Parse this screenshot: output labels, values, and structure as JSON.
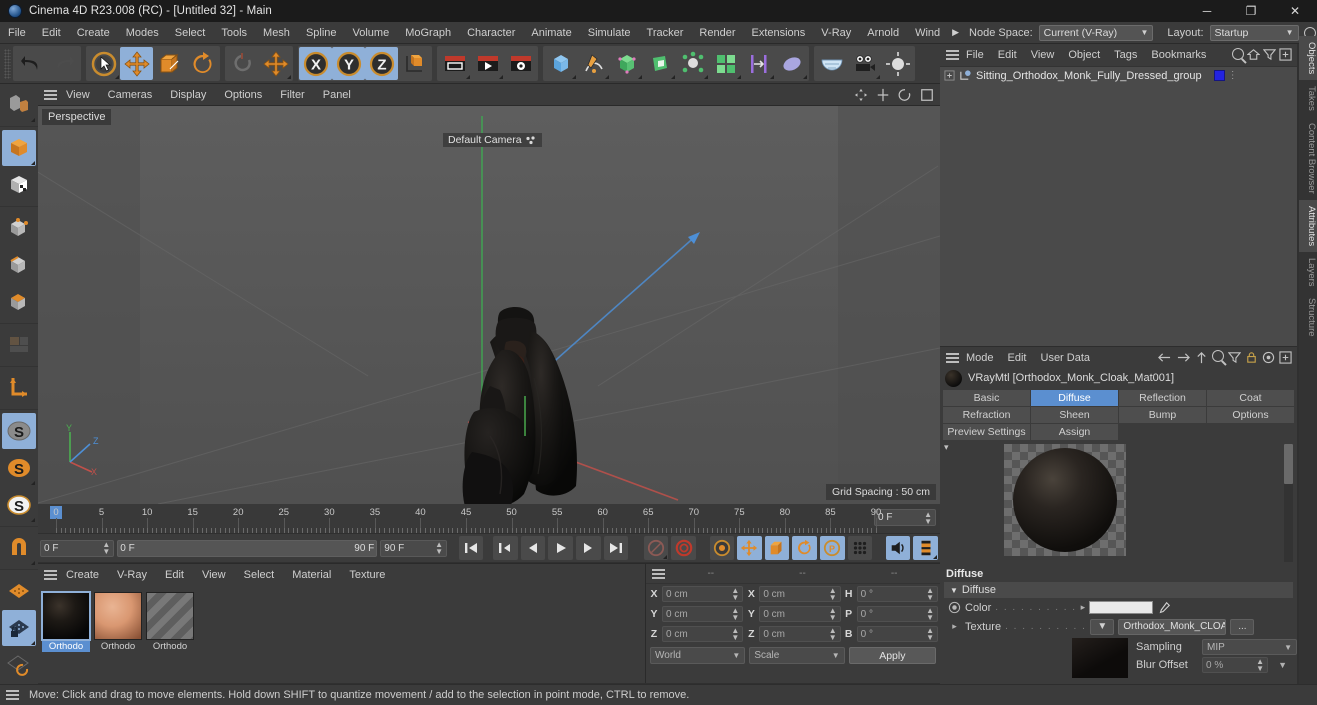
{
  "window": {
    "title": "Cinema 4D R23.008 (RC) - [Untitled 32] - Main",
    "minimize": "─",
    "maximize": "❐",
    "close": "✕"
  },
  "menubar": {
    "items": [
      "File",
      "Edit",
      "Create",
      "Modes",
      "Select",
      "Tools",
      "Mesh",
      "Spline",
      "Volume",
      "MoGraph",
      "Character",
      "Animate",
      "Simulate",
      "Tracker",
      "Render",
      "Extensions",
      "V-Ray",
      "Arnold",
      "Wind"
    ],
    "overflow_arrow": "▶",
    "node_space_label": "Node Space:",
    "node_space_value": "Current (V-Ray)",
    "layout_label": "Layout:",
    "layout_value": "Startup"
  },
  "viewport": {
    "menu": [
      "View",
      "Cameras",
      "Display",
      "Options",
      "Filter",
      "Panel"
    ],
    "label": "Perspective",
    "camera_label": "Default Camera",
    "grid_spacing": "Grid Spacing : 50 cm",
    "axis": {
      "x": "X",
      "y": "Y",
      "z": "Z"
    }
  },
  "timeline": {
    "ticks": [
      "0",
      "5",
      "10",
      "15",
      "20",
      "25",
      "30",
      "35",
      "40",
      "45",
      "50",
      "55",
      "60",
      "65",
      "70",
      "75",
      "80",
      "85",
      "90"
    ],
    "current_frame": "0 F",
    "start_frame": "0 F",
    "preview_start": "0 F",
    "preview_end": "90 F",
    "end_frame": "90 F",
    "transport": [
      "⏮",
      "◀▏",
      "◀",
      "▶",
      "▶▏",
      "⏭"
    ]
  },
  "materials": {
    "menu": [
      "Create",
      "V-Ray",
      "Edit",
      "View",
      "Select",
      "Material",
      "Texture"
    ],
    "items": [
      {
        "name": "Orthodo",
        "selected": true,
        "kind": "dark"
      },
      {
        "name": "Orthodo",
        "selected": false,
        "kind": "skin"
      },
      {
        "name": "Orthodo",
        "selected": false,
        "kind": "stripe"
      }
    ]
  },
  "coordinates": {
    "headers": [
      "--",
      "--",
      "--"
    ],
    "rows": [
      {
        "l1": "X",
        "v1": "0 cm",
        "l2": "X",
        "v2": "0 cm",
        "l3": "H",
        "v3": "0 °"
      },
      {
        "l1": "Y",
        "v1": "0 cm",
        "l2": "Y",
        "v2": "0 cm",
        "l3": "P",
        "v3": "0 °"
      },
      {
        "l1": "Z",
        "v1": "0 cm",
        "l2": "Z",
        "v2": "0 cm",
        "l3": "B",
        "v3": "0 °"
      }
    ],
    "space": "World",
    "mode": "Scale",
    "apply": "Apply"
  },
  "objects": {
    "menu": [
      "File",
      "Edit",
      "View",
      "Object",
      "Tags",
      "Bookmarks"
    ],
    "tree": [
      {
        "name": "Sitting_Orthodox_Monk_Fully_Dressed_group"
      }
    ]
  },
  "attributes": {
    "menu": [
      "Mode",
      "Edit",
      "User Data"
    ],
    "material_title": "VRayMtl [Orthodox_Monk_Cloak_Mat001]",
    "tabs_row1": [
      "Basic",
      "Diffuse",
      "Reflection",
      "Coat"
    ],
    "tabs_row2": [
      "Refraction",
      "Sheen",
      "Bump",
      "Options"
    ],
    "tabs_row3": [
      "Preview Settings",
      "Assign"
    ],
    "active_tab": "Diffuse",
    "section_title": "Diffuse",
    "group_title": "Diffuse",
    "color_label": "Color",
    "color_dots": ". . . . . . . . . .",
    "color_value": "#e9e9e9",
    "texture_label": "Texture",
    "texture_dots": ". . . . . . . . . .",
    "texture_value": "Orthodox_Monk_CLOAK_Ba",
    "texture_browse": "...",
    "sampling_label": "Sampling",
    "sampling_value": "MIP",
    "blur_label": "Blur Offset",
    "blur_value": "0 %"
  },
  "side_tabs": [
    {
      "label": "Objects",
      "active": true
    },
    {
      "label": "Takes",
      "active": false
    },
    {
      "label": "Content Browser",
      "active": false
    },
    {
      "label": "Attributes",
      "active": true
    },
    {
      "label": "Layers",
      "active": false
    },
    {
      "label": "Structure",
      "active": false
    }
  ],
  "statusbar": {
    "message": "Move: Click and drag to move elements. Hold down SHIFT to quantize movement / add to the selection in point mode, CTRL to remove."
  },
  "icons": {
    "undo": "undo-icon",
    "redo": "redo-icon",
    "live_selection": "live-selection-icon",
    "move": "move-tool-icon",
    "scale": "scale-tool-icon",
    "rotate": "rotate-tool-icon",
    "axis_x": "X",
    "axis_y": "Y",
    "axis_z": "Z"
  }
}
